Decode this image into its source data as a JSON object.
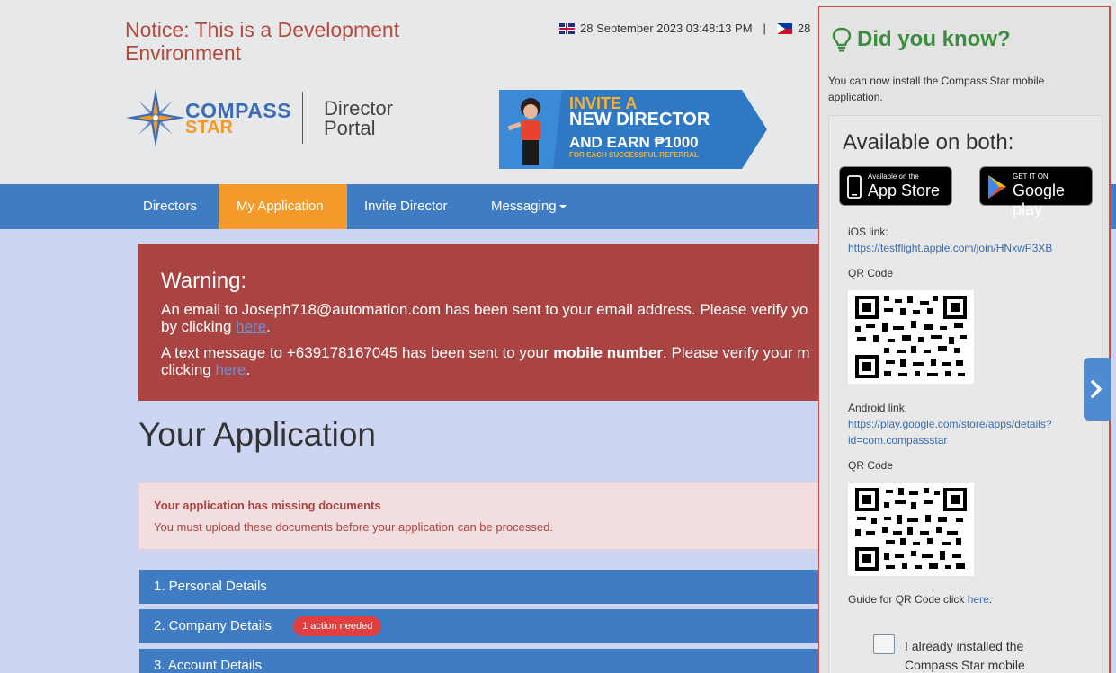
{
  "header": {
    "notice": "Notice: This is a Development Environment",
    "datetime_uk": "28 September 2023 03:48:13 PM",
    "separator": "|",
    "datetime_ph": "28",
    "logo": {
      "line1": "COMPASS",
      "line2": "STAR",
      "portal_line1": "Director",
      "portal_line2": "Portal"
    },
    "banner": {
      "line1": "INVITE A",
      "line2": "NEW DIRECTOR",
      "line3": "AND EARN ₱1000",
      "line4": "FOR EACH SUCCESSFUL REFERRAL"
    }
  },
  "nav": {
    "items": [
      {
        "label": "Directors"
      },
      {
        "label": "My Application"
      },
      {
        "label": "Invite Director"
      },
      {
        "label": "Messaging"
      }
    ]
  },
  "warning": {
    "title": "Warning:",
    "email_line1": "An email to Joseph718@automation.com has been sent to your email address. Please verify yo",
    "email_line2_prefix": "by clicking ",
    "link": "here",
    "end": ".",
    "sms_line1_prefix": "A text message to +639178167045 has been sent to your ",
    "sms_bold": "mobile number",
    "sms_line1_suffix": ". Please verify your m",
    "sms_line2_prefix": "clicking "
  },
  "main": {
    "title": "Your Application",
    "missing_title": "Your application has missing documents",
    "missing_text": "You must upload these documents before your application can be processed.",
    "sections": [
      {
        "label": "1. Personal Details"
      },
      {
        "label": "2. Company Details",
        "badge": "1 action needed"
      },
      {
        "label": "3. Account Details"
      }
    ]
  },
  "panel": {
    "title": "Did you know?",
    "desc": "You can now install the Compass Star mobile application.",
    "available": "Available on both:",
    "appstore_small": "Available on the",
    "appstore_big": "App Store",
    "gplay_small": "GET IT ON",
    "gplay_big": "Google play",
    "ios_label": "iOS link:",
    "ios_link": "https://testflight.apple.com/join/HNxwP3XB",
    "qr_label": "QR Code",
    "android_label": "Android link:",
    "android_link": "https://play.google.com/store/apps/details?id=com.compassstar",
    "guide_prefix": "Guide for QR Code click ",
    "guide_link": "here",
    "guide_suffix": ".",
    "checkbox_label": "I already installed the Compass Star mobile"
  },
  "colors": {
    "navbar": "#3f7cc4",
    "active_tab": "#f39a2a",
    "warning": "#a94442",
    "accent_green": "#3c8c3d"
  }
}
